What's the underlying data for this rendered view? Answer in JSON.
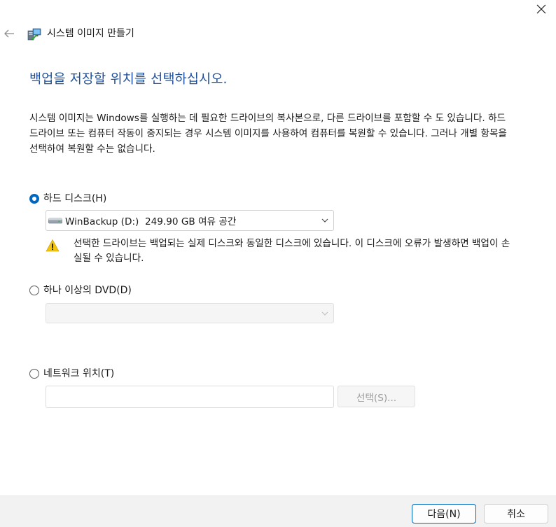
{
  "window": {
    "title": "시스템 이미지 만들기",
    "close_icon": "close-icon",
    "back_icon": "back-arrow-icon",
    "app_icon": "system-image-backup-icon"
  },
  "main": {
    "heading": "백업을 저장할 위치를 선택하십시오.",
    "description": "시스템 이미지는 Windows를 실행하는 데 필요한 드라이브의 복사본으로, 다른 드라이브를 포함할 수 도 있습니다. 하드 드라이브 또는 컴퓨터 작동이 중지되는 경우 시스템 이미지를 사용하여 컴퓨터를 복원할 수 있습니다. 그러나 개별 항목을 선택하여 복원할 수는 없습니다."
  },
  "options": {
    "hard_disk": {
      "label": "하드 디스크(H)",
      "selected": true,
      "dropdown_value": "WinBackup (D:)  249.90 GB 여유 공간",
      "warning": "선택한 드라이브는 백업되는 실제 디스크와 동일한 디스크에 있습니다. 이 디스크에 오류가 발생하면 백업이 손실될 수 있습니다."
    },
    "dvd": {
      "label": "하나 이상의 DVD(D)",
      "selected": false,
      "dropdown_value": ""
    },
    "network": {
      "label": "네트워크 위치(T)",
      "selected": false,
      "path_value": "",
      "browse_label": "선택(S)..."
    }
  },
  "footer": {
    "next_label": "다음(N)",
    "cancel_label": "취소"
  },
  "colors": {
    "accent": "#0067c0",
    "heading": "#1e4f9a",
    "warning": "#f2c40f",
    "footer_bg": "#f2f2f2"
  }
}
